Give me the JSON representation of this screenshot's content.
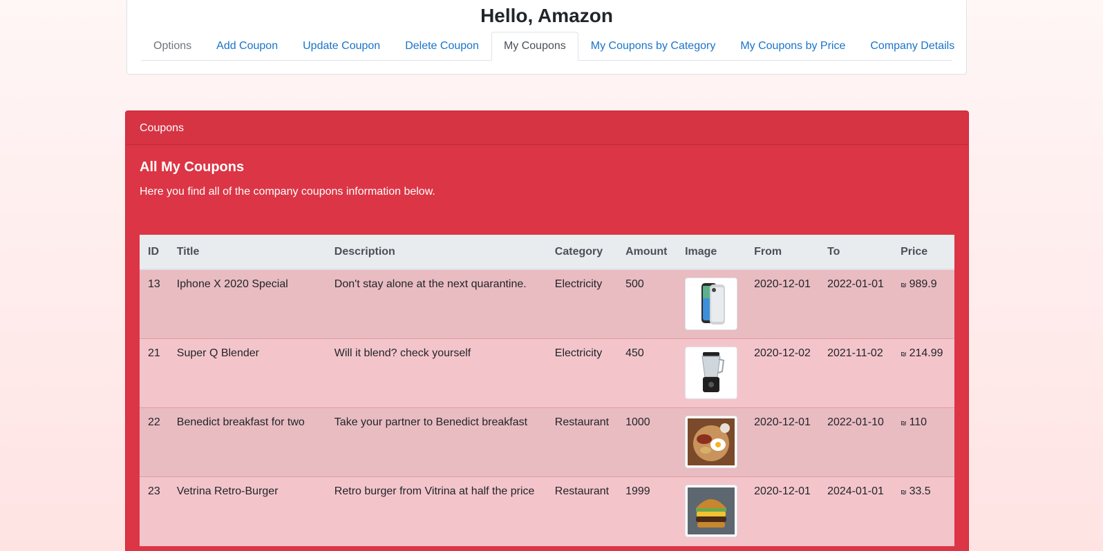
{
  "header": {
    "greeting": "Hello, Amazon",
    "tabs": [
      {
        "label": "Options",
        "state": "disabled"
      },
      {
        "label": "Add Coupon",
        "state": "link"
      },
      {
        "label": "Update Coupon",
        "state": "link"
      },
      {
        "label": "Delete Coupon",
        "state": "link"
      },
      {
        "label": "My Coupons",
        "state": "active"
      },
      {
        "label": "My Coupons by Category",
        "state": "link"
      },
      {
        "label": "My Coupons by Price",
        "state": "link"
      },
      {
        "label": "Company Details",
        "state": "link"
      }
    ]
  },
  "panel": {
    "header": "Coupons",
    "title": "All My Coupons",
    "text": "Here you find all of the company coupons information below."
  },
  "table": {
    "columns": [
      "ID",
      "Title",
      "Description",
      "Category",
      "Amount",
      "Image",
      "From",
      "To",
      "Price"
    ],
    "currency_symbol": "₪",
    "rows": [
      {
        "id": "13",
        "title": "Iphone X 2020 Special",
        "description": "Don't stay alone at the next quarantine.",
        "category": "Electricity",
        "amount": "500",
        "image": "iphone-image",
        "from": "2020-12-01",
        "to": "2022-01-01",
        "price": "989.9"
      },
      {
        "id": "21",
        "title": "Super Q Blender",
        "description": "Will it blend? check yourself",
        "category": "Electricity",
        "amount": "450",
        "image": "blender-image",
        "from": "2020-12-02",
        "to": "2021-11-02",
        "price": "214.99"
      },
      {
        "id": "22",
        "title": "Benedict breakfast for two",
        "description": "Take your partner to Benedict breakfast",
        "category": "Restaurant",
        "amount": "1000",
        "image": "breakfast-image",
        "from": "2020-12-01",
        "to": "2022-01-10",
        "price": "110"
      },
      {
        "id": "23",
        "title": "Vetrina Retro-Burger",
        "description": "Retro burger from Vitrina at half the price",
        "category": "Restaurant",
        "amount": "1999",
        "image": "burger-image",
        "from": "2020-12-01",
        "to": "2024-01-01",
        "price": "33.5"
      }
    ]
  },
  "colors": {
    "panel": "#dc3545",
    "link": "#1a73c8",
    "row_odd": "#e9bcc2",
    "row_even": "#f3c5cb"
  }
}
